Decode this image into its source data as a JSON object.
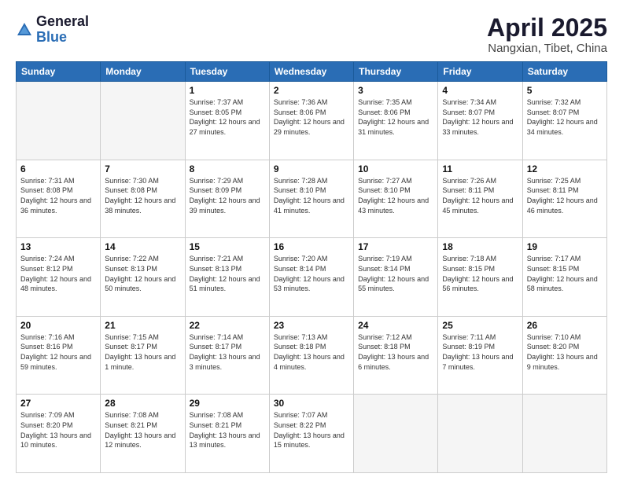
{
  "logo": {
    "general": "General",
    "blue": "Blue"
  },
  "title": {
    "main": "April 2025",
    "sub": "Nangxian, Tibet, China"
  },
  "weekdays": [
    "Sunday",
    "Monday",
    "Tuesday",
    "Wednesday",
    "Thursday",
    "Friday",
    "Saturday"
  ],
  "weeks": [
    [
      {
        "day": "",
        "sunrise": "",
        "sunset": "",
        "daylight": "",
        "empty": true
      },
      {
        "day": "",
        "sunrise": "",
        "sunset": "",
        "daylight": "",
        "empty": true
      },
      {
        "day": "1",
        "sunrise": "Sunrise: 7:37 AM",
        "sunset": "Sunset: 8:05 PM",
        "daylight": "Daylight: 12 hours and 27 minutes."
      },
      {
        "day": "2",
        "sunrise": "Sunrise: 7:36 AM",
        "sunset": "Sunset: 8:06 PM",
        "daylight": "Daylight: 12 hours and 29 minutes."
      },
      {
        "day": "3",
        "sunrise": "Sunrise: 7:35 AM",
        "sunset": "Sunset: 8:06 PM",
        "daylight": "Daylight: 12 hours and 31 minutes."
      },
      {
        "day": "4",
        "sunrise": "Sunrise: 7:34 AM",
        "sunset": "Sunset: 8:07 PM",
        "daylight": "Daylight: 12 hours and 33 minutes."
      },
      {
        "day": "5",
        "sunrise": "Sunrise: 7:32 AM",
        "sunset": "Sunset: 8:07 PM",
        "daylight": "Daylight: 12 hours and 34 minutes."
      }
    ],
    [
      {
        "day": "6",
        "sunrise": "Sunrise: 7:31 AM",
        "sunset": "Sunset: 8:08 PM",
        "daylight": "Daylight: 12 hours and 36 minutes."
      },
      {
        "day": "7",
        "sunrise": "Sunrise: 7:30 AM",
        "sunset": "Sunset: 8:08 PM",
        "daylight": "Daylight: 12 hours and 38 minutes."
      },
      {
        "day": "8",
        "sunrise": "Sunrise: 7:29 AM",
        "sunset": "Sunset: 8:09 PM",
        "daylight": "Daylight: 12 hours and 39 minutes."
      },
      {
        "day": "9",
        "sunrise": "Sunrise: 7:28 AM",
        "sunset": "Sunset: 8:10 PM",
        "daylight": "Daylight: 12 hours and 41 minutes."
      },
      {
        "day": "10",
        "sunrise": "Sunrise: 7:27 AM",
        "sunset": "Sunset: 8:10 PM",
        "daylight": "Daylight: 12 hours and 43 minutes."
      },
      {
        "day": "11",
        "sunrise": "Sunrise: 7:26 AM",
        "sunset": "Sunset: 8:11 PM",
        "daylight": "Daylight: 12 hours and 45 minutes."
      },
      {
        "day": "12",
        "sunrise": "Sunrise: 7:25 AM",
        "sunset": "Sunset: 8:11 PM",
        "daylight": "Daylight: 12 hours and 46 minutes."
      }
    ],
    [
      {
        "day": "13",
        "sunrise": "Sunrise: 7:24 AM",
        "sunset": "Sunset: 8:12 PM",
        "daylight": "Daylight: 12 hours and 48 minutes."
      },
      {
        "day": "14",
        "sunrise": "Sunrise: 7:22 AM",
        "sunset": "Sunset: 8:13 PM",
        "daylight": "Daylight: 12 hours and 50 minutes."
      },
      {
        "day": "15",
        "sunrise": "Sunrise: 7:21 AM",
        "sunset": "Sunset: 8:13 PM",
        "daylight": "Daylight: 12 hours and 51 minutes."
      },
      {
        "day": "16",
        "sunrise": "Sunrise: 7:20 AM",
        "sunset": "Sunset: 8:14 PM",
        "daylight": "Daylight: 12 hours and 53 minutes."
      },
      {
        "day": "17",
        "sunrise": "Sunrise: 7:19 AM",
        "sunset": "Sunset: 8:14 PM",
        "daylight": "Daylight: 12 hours and 55 minutes."
      },
      {
        "day": "18",
        "sunrise": "Sunrise: 7:18 AM",
        "sunset": "Sunset: 8:15 PM",
        "daylight": "Daylight: 12 hours and 56 minutes."
      },
      {
        "day": "19",
        "sunrise": "Sunrise: 7:17 AM",
        "sunset": "Sunset: 8:15 PM",
        "daylight": "Daylight: 12 hours and 58 minutes."
      }
    ],
    [
      {
        "day": "20",
        "sunrise": "Sunrise: 7:16 AM",
        "sunset": "Sunset: 8:16 PM",
        "daylight": "Daylight: 12 hours and 59 minutes."
      },
      {
        "day": "21",
        "sunrise": "Sunrise: 7:15 AM",
        "sunset": "Sunset: 8:17 PM",
        "daylight": "Daylight: 13 hours and 1 minute."
      },
      {
        "day": "22",
        "sunrise": "Sunrise: 7:14 AM",
        "sunset": "Sunset: 8:17 PM",
        "daylight": "Daylight: 13 hours and 3 minutes."
      },
      {
        "day": "23",
        "sunrise": "Sunrise: 7:13 AM",
        "sunset": "Sunset: 8:18 PM",
        "daylight": "Daylight: 13 hours and 4 minutes."
      },
      {
        "day": "24",
        "sunrise": "Sunrise: 7:12 AM",
        "sunset": "Sunset: 8:18 PM",
        "daylight": "Daylight: 13 hours and 6 minutes."
      },
      {
        "day": "25",
        "sunrise": "Sunrise: 7:11 AM",
        "sunset": "Sunset: 8:19 PM",
        "daylight": "Daylight: 13 hours and 7 minutes."
      },
      {
        "day": "26",
        "sunrise": "Sunrise: 7:10 AM",
        "sunset": "Sunset: 8:20 PM",
        "daylight": "Daylight: 13 hours and 9 minutes."
      }
    ],
    [
      {
        "day": "27",
        "sunrise": "Sunrise: 7:09 AM",
        "sunset": "Sunset: 8:20 PM",
        "daylight": "Daylight: 13 hours and 10 minutes."
      },
      {
        "day": "28",
        "sunrise": "Sunrise: 7:08 AM",
        "sunset": "Sunset: 8:21 PM",
        "daylight": "Daylight: 13 hours and 12 minutes."
      },
      {
        "day": "29",
        "sunrise": "Sunrise: 7:08 AM",
        "sunset": "Sunset: 8:21 PM",
        "daylight": "Daylight: 13 hours and 13 minutes."
      },
      {
        "day": "30",
        "sunrise": "Sunrise: 7:07 AM",
        "sunset": "Sunset: 8:22 PM",
        "daylight": "Daylight: 13 hours and 15 minutes."
      },
      {
        "day": "",
        "sunrise": "",
        "sunset": "",
        "daylight": "",
        "empty": true
      },
      {
        "day": "",
        "sunrise": "",
        "sunset": "",
        "daylight": "",
        "empty": true
      },
      {
        "day": "",
        "sunrise": "",
        "sunset": "",
        "daylight": "",
        "empty": true
      }
    ]
  ]
}
